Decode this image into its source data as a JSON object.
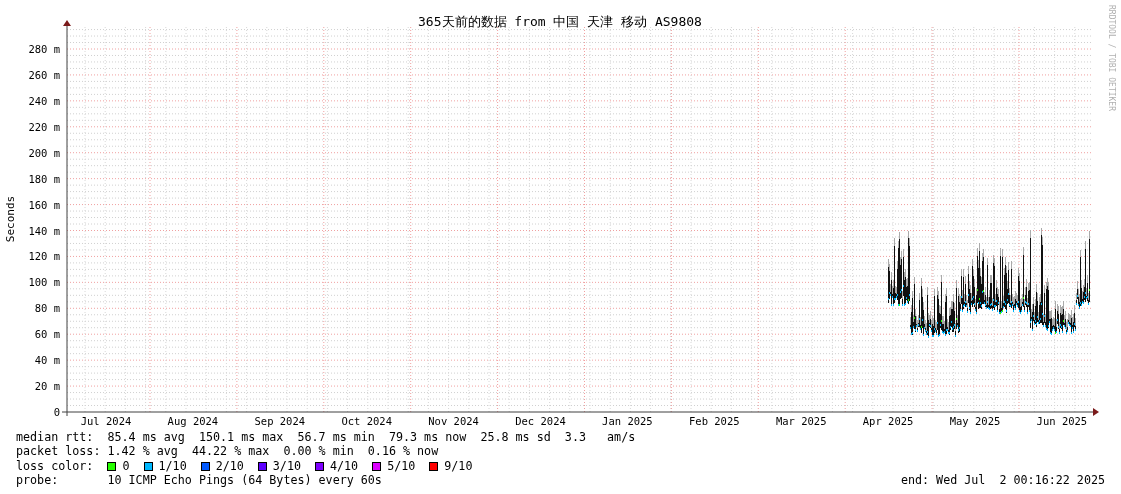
{
  "title": "365天前的数据 from 中国 天津 移动 AS9808",
  "credit": "RRDTOOL / TOBI OETIKER",
  "y_axis": {
    "label": "Seconds",
    "ticks": [
      "280 m",
      "260 m",
      "240 m",
      "220 m",
      "200 m",
      "180 m",
      "160 m",
      "140 m",
      "120 m",
      "100 m",
      "80 m",
      "60 m",
      "40 m",
      "20 m",
      "0"
    ]
  },
  "x_axis": {
    "ticks": [
      "Jul 2024",
      "Aug 2024",
      "Sep 2024",
      "Oct 2024",
      "Nov 2024",
      "Dec 2024",
      "Jan 2025",
      "Feb 2025",
      "Mar 2025",
      "Apr 2025",
      "May 2025",
      "Jun 2025"
    ]
  },
  "stats": [
    {
      "label": "median rtt:",
      "text": "85.4 ms avg  150.1 ms max  56.7 ms min  79.3 ms now  25.8 ms sd  3.3   am/s"
    },
    {
      "label": "packet loss:",
      "text": "1.42 % avg  44.22 % max  0.00 % min  0.16 % now"
    }
  ],
  "loss_color": {
    "label": "loss color:",
    "items": [
      {
        "label": "0",
        "color": "#26ff00"
      },
      {
        "label": "1/10",
        "color": "#00b8ff"
      },
      {
        "label": "2/10",
        "color": "#0059ff"
      },
      {
        "label": "3/10",
        "color": "#5e00ff"
      },
      {
        "label": "4/10",
        "color": "#7e00ff"
      },
      {
        "label": "5/10",
        "color": "#dd00ff"
      },
      {
        "label": "9/10",
        "color": "#ff0000"
      }
    ]
  },
  "probe": {
    "label": "probe:",
    "text": "10 ICMP Echo Pings (64 Bytes) every 60s"
  },
  "end": "end: Wed Jul  2 00:16:22 2025"
}
